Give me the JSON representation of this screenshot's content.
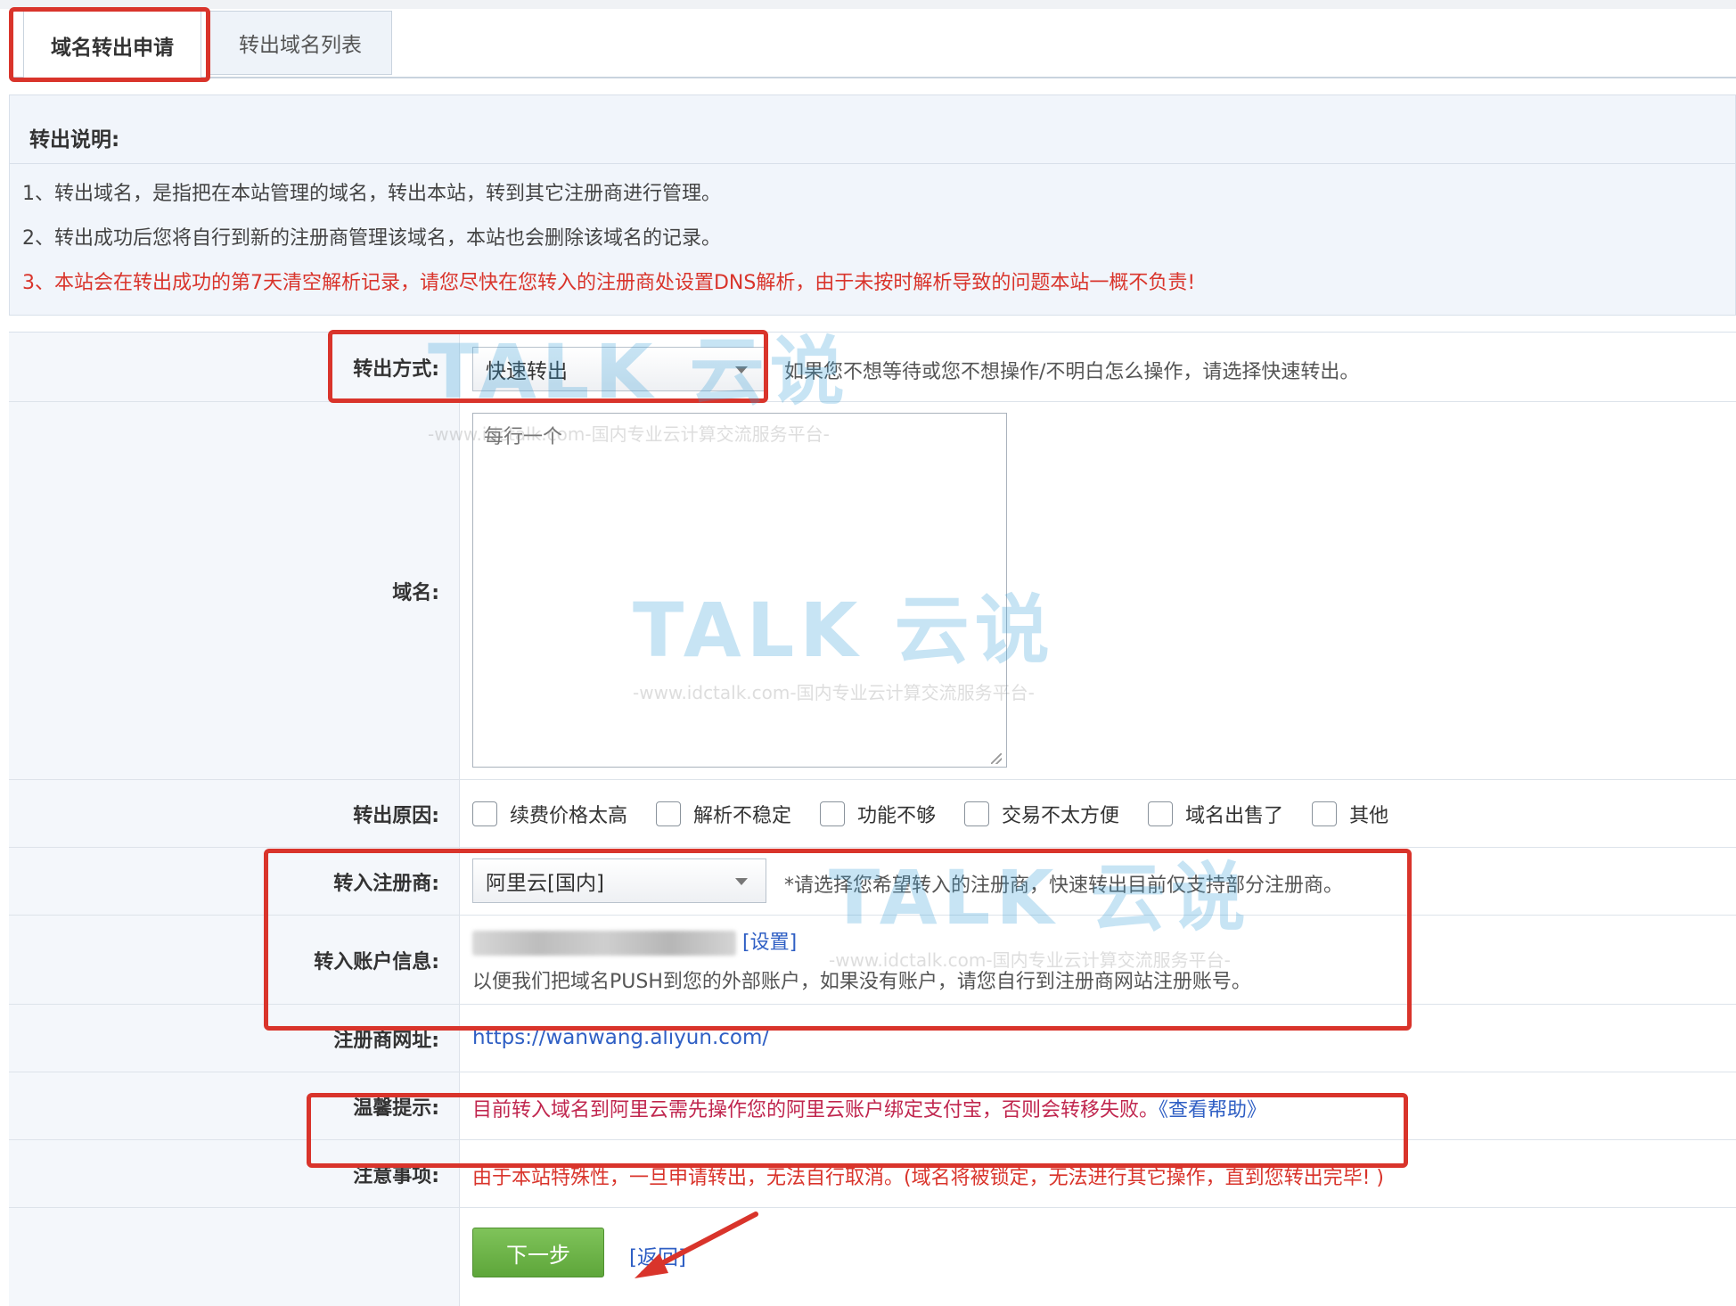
{
  "tabs": [
    {
      "label": "域名转出申请",
      "active": true
    },
    {
      "label": "转出域名列表",
      "active": false
    }
  ],
  "notice": {
    "title": "转出说明:",
    "lines": [
      "1、转出域名，是指把在本站管理的域名，转出本站，转到其它注册商进行管理。",
      "2、转出成功后您将自行到新的注册商管理该域名，本站也会删除该域名的记录。",
      "3、本站会在转出成功的第7天清空解析记录，请您尽快在您转入的注册商处设置DNS解析，由于未按时解析导致的问题本站一概不负责!"
    ]
  },
  "form": {
    "method": {
      "label": "转出方式:",
      "value": "快速转出",
      "hint": "如果您不想等待或您不想操作/不明白怎么操作，请选择快速转出。"
    },
    "domain": {
      "label": "域名:",
      "placeholder": "每行一个"
    },
    "reason": {
      "label": "转出原因:",
      "options": [
        "续费价格太高",
        "解析不稳定",
        "功能不够",
        "交易不太方便",
        "域名出售了",
        "其他"
      ]
    },
    "registrar": {
      "label": "转入注册商:",
      "value": "阿里云[国内]",
      "hint": "*请选择您希望转入的注册商，快速转出目前仅支持部分注册商。"
    },
    "account": {
      "label": "转入账户信息:",
      "set_link": "[设置]",
      "hint": "以便我们把域名PUSH到您的外部账户，如果没有账户，请您自行到注册商网站注册账号。"
    },
    "url": {
      "label": "注册商网址:",
      "value": "https://wanwang.aliyun.com/"
    },
    "tip": {
      "label": "温馨提示:",
      "text": "目前转入域名到阿里云需先操作您的阿里云账户绑定支付宝，否则会转移失败。",
      "help_link": "《查看帮助》"
    },
    "caution": {
      "label": "注意事项:",
      "text": "由于本站特殊性，一旦申请转出，无法自行取消。(域名将被锁定，无法进行其它操作，直到您转出完毕! )"
    },
    "next_button": "下一步",
    "back_link": "[返回]"
  },
  "watermark": {
    "brand": "TALK 云说",
    "url": "-www.idctalk.com-国内专业云计算交流服务平台-"
  },
  "colors": {
    "red": "#d9342b",
    "link": "#2f5fc4",
    "button_green": "#6cb347",
    "tip_purple": "#b0257a"
  }
}
